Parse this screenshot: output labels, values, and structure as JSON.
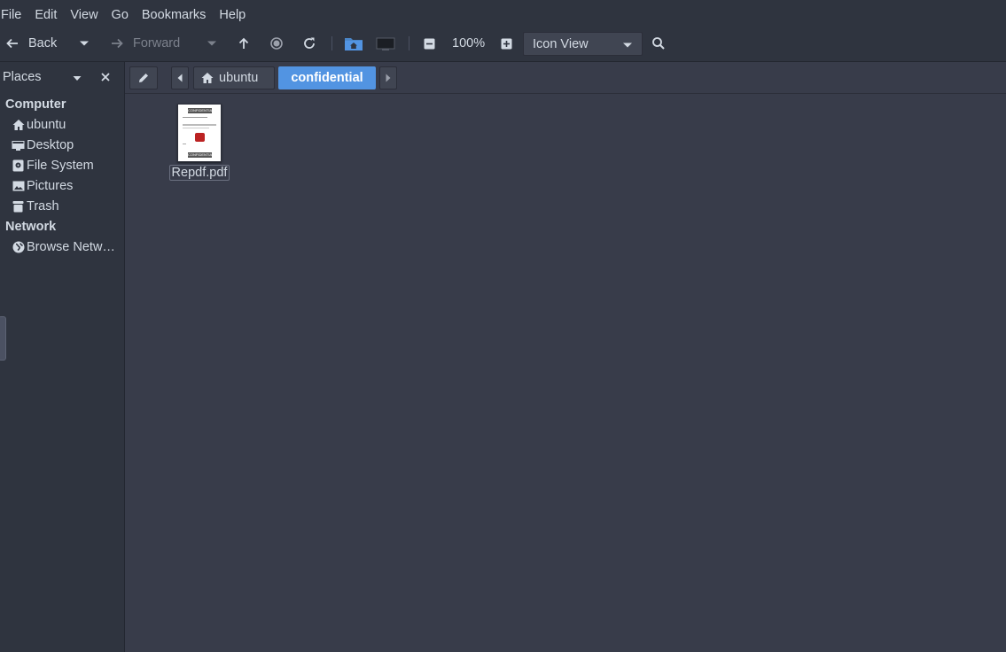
{
  "menubar": {
    "items": [
      "File",
      "Edit",
      "View",
      "Go",
      "Bookmarks",
      "Help"
    ]
  },
  "toolbar": {
    "back_label": "Back",
    "forward_label": "Forward",
    "zoom_level": "100%",
    "view_mode": "Icon View"
  },
  "sidebar": {
    "title": "Places",
    "computer_heading": "Computer",
    "network_heading": "Network",
    "items": [
      {
        "label": "ubuntu",
        "icon": "home-icon"
      },
      {
        "label": "Desktop",
        "icon": "desktop-icon"
      },
      {
        "label": "File System",
        "icon": "drive-icon"
      },
      {
        "label": "Pictures",
        "icon": "pictures-icon"
      },
      {
        "label": "Trash",
        "icon": "trash-icon"
      }
    ],
    "network_items": [
      {
        "label": "Browse Netw…",
        "icon": "network-icon"
      }
    ]
  },
  "breadcrumb": {
    "crumbs": [
      "ubuntu",
      "confidential"
    ],
    "active": "confidential"
  },
  "files": [
    {
      "name": "Repdf.pdf",
      "thumb_header": "CONFIDENTIAL",
      "thumb_footer": "CONFIDENTIAL"
    }
  ],
  "colors": {
    "accent": "#5294e2",
    "background": "#383c4a",
    "panel": "#2f343f"
  }
}
